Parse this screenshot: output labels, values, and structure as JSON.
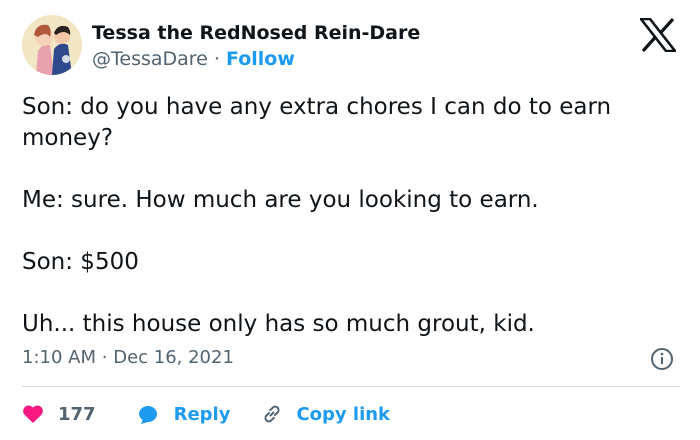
{
  "tweet": {
    "author_name": "Tessa the RedNosed Rein-Dare",
    "handle": "@TessaDare",
    "separator": "·",
    "follow_label": "Follow",
    "paragraphs": [
      "Son: do you have any extra chores I can do to earn money?",
      "Me: sure. How much are you looking to earn.",
      "Son: $500",
      "Uh... this house only has so much grout, kid."
    ],
    "time": "1:10 AM",
    "date": "Dec 16, 2021",
    "likes": "177",
    "reply_label": "Reply",
    "copy_label": "Copy link"
  },
  "icons": {
    "logo": "x-logo-icon",
    "info": "info-icon",
    "like": "heart-icon",
    "reply": "speech-bubble-icon",
    "copy": "link-icon"
  },
  "colors": {
    "accent": "#1d9bf0",
    "heart": "#f91880",
    "secondary_text": "#536471",
    "divider": "#cfd9de"
  }
}
